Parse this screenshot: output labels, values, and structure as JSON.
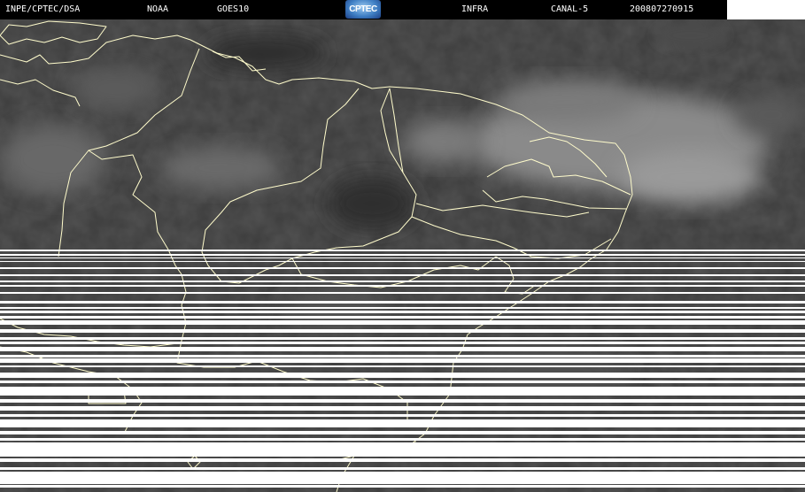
{
  "header": {
    "source": "INPE/CPTEC/DSA",
    "agency": "NOAA",
    "satellite": "GOES10",
    "logo_text": "CPTEC",
    "product": "INFRA",
    "channel": "CANAL-5",
    "timestamp": "200807270915"
  },
  "colors": {
    "header_bg": "#000000",
    "header_text": "#ffffff",
    "map_lines": "#fffccc",
    "gap_lines": "#ffffff",
    "cloud_bright": "#b4b4b4",
    "ground_dark": "#2e2e2e"
  }
}
